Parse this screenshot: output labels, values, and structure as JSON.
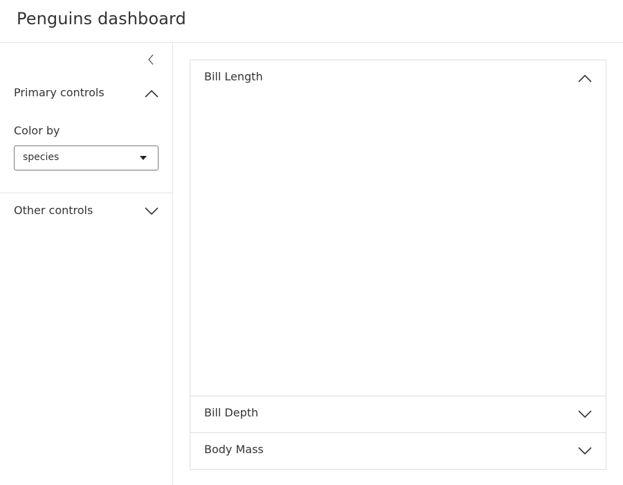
{
  "header": {
    "title": "Penguins dashboard"
  },
  "sidebar": {
    "collapse_icon": "chevron-left-icon",
    "sections": [
      {
        "title": "Primary controls",
        "expanded": true,
        "icon": "chevron-up-icon"
      },
      {
        "title": "Other controls",
        "expanded": false,
        "icon": "chevron-down-icon"
      }
    ],
    "color_by": {
      "label": "Color by",
      "value": "species",
      "caret_icon": "caret-down-icon"
    }
  },
  "main": {
    "cards": [
      {
        "title": "Bill Length",
        "expanded": true,
        "icon": "chevron-up-icon"
      },
      {
        "title": "Bill Depth",
        "expanded": false,
        "icon": "chevron-down-icon"
      },
      {
        "title": "Body Mass",
        "expanded": false,
        "icon": "chevron-down-icon"
      }
    ]
  },
  "colors": {
    "text": "#333333",
    "border": "#e6e6e6",
    "panel_border": "#dcdcdc",
    "select_border": "#777777"
  }
}
